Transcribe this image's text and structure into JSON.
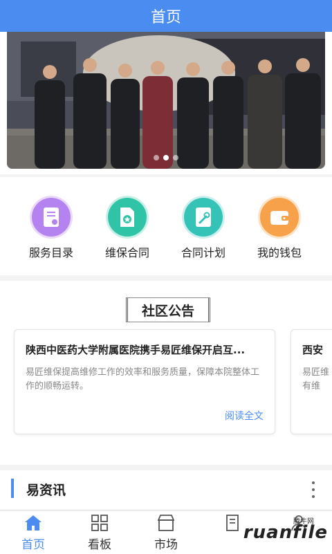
{
  "header": {
    "title": "首页"
  },
  "banner": {
    "slides": 3,
    "active_slide": 2
  },
  "quick_actions": [
    {
      "label": "服务目录",
      "icon": "certificate-icon",
      "color": "#b483f0"
    },
    {
      "label": "维保合同",
      "icon": "contract-icon",
      "color": "#2fc4a6"
    },
    {
      "label": "合同计划",
      "icon": "wrench-icon",
      "color": "#35c2b7"
    },
    {
      "label": "我的钱包",
      "icon": "wallet-icon",
      "color": "#f7a24a"
    }
  ],
  "notice": {
    "title": "社区公告",
    "cards": [
      {
        "title": "陕西中医药大学附属医院携手易匠维保开启互...",
        "body": "易匠维保提高维修工作的效率和服务质量，保障本院整体工作的顺畅运转。",
        "more": "阅读全文"
      },
      {
        "title": "西安",
        "body": "易匠维\n有维"
      }
    ]
  },
  "news": {
    "title": "易资讯"
  },
  "tabbar": {
    "items": [
      {
        "label": "首页",
        "icon": "home-icon",
        "active": true
      },
      {
        "label": "看板",
        "icon": "grid-icon",
        "active": false
      },
      {
        "label": "市场",
        "icon": "store-icon",
        "active": false
      },
      {
        "label": "",
        "icon": "document-icon",
        "active": false
      },
      {
        "label": "",
        "icon": "user-icon",
        "active": false
      }
    ]
  },
  "watermark": {
    "text": "ruanfile",
    "small": "腾牛网"
  }
}
